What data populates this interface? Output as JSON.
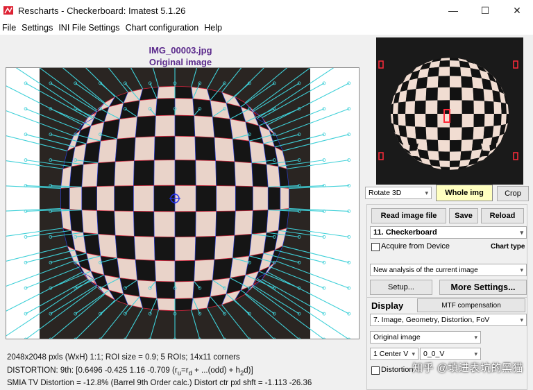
{
  "window": {
    "title": "Rescharts - Checkerboard:  Imatest 5.1.26",
    "minimize_glyph": "—",
    "maximize_glyph": "☐",
    "close_glyph": "✕"
  },
  "menu": [
    "File",
    "Settings",
    "INI File Settings",
    "Chart configuration",
    "Help"
  ],
  "main": {
    "filename": "IMG_00003.jpg",
    "subtitle": "Original image",
    "info1": "2048x2048 pxls (WxH) 1:1;    ROI size = 0.9;   5 ROIs;   14x11 corners",
    "info2": "DISTORTION:  9th: [0.6496  -0.425  1.16  -0.709  (r",
    "info2_u": "u",
    "info2_mid": "=r",
    "info2_d": "d",
    "info2_tail": " + ...(odd) + h",
    "info2_h": "2",
    "info2_end": "d",
    "info2_close": ")]",
    "info3": "SMIA TV Distortion = -12.8%  (Barrel   9th Order calc.)  Distort ctr pxl shft = -1.113 -26.36"
  },
  "side": {
    "rotate_select": "Rotate 3D",
    "whole_img_button": "Whole img",
    "crop_button": "Crop",
    "read_image_button": "Read image file",
    "save_button": "Save",
    "reload_button": "Reload",
    "chart_select": "11. Checkerboard",
    "acquire_label": "Acquire from Device",
    "chart_type_label": "Chart type",
    "analysis_select": "New analysis of the current image",
    "setup_button": "Setup...",
    "more_settings_button": "More Settings...",
    "display_tab": "Display",
    "mtf_tab": "MTF compensation",
    "display_select": "7. Image, Geometry, Distortion, FoV",
    "image_select": "Original image",
    "roi_select": "1  Center  V",
    "roi_value_select": "0_0_V",
    "distortion_checkbox": "Distortion",
    "watermark": "知乎 @填进表坑的黑猫"
  },
  "colors": {
    "title_purple": "#5b2a8c",
    "arrow_cyan": "#3fd0d8",
    "grid_red": "#d0243c",
    "grid_blue": "#2a3fd0",
    "whole_img_yellow": "#ffffc0"
  }
}
